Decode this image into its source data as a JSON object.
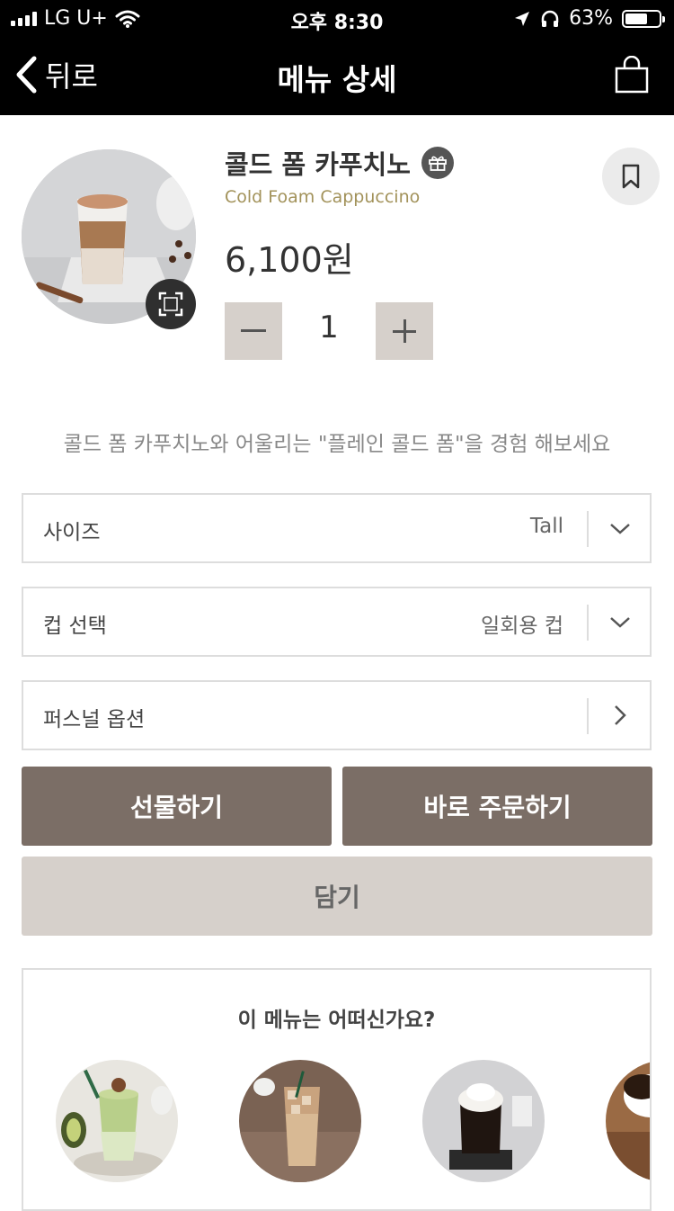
{
  "status_bar": {
    "carrier": "LG U+",
    "time": "오후 8:30",
    "battery": "63%"
  },
  "nav": {
    "back_label": "뒤로",
    "title": "메뉴 상세"
  },
  "product": {
    "name": "콜드 폼 카푸치노",
    "name_en": "Cold Foam Cappuccino",
    "price": "6,100원",
    "quantity": "1"
  },
  "promo_text": "콜드 폼 카푸치노와 어울리는 \"플레인 콜드 폼\"을 경험 해보세요",
  "options": {
    "size": {
      "label": "사이즈",
      "value": "Tall"
    },
    "cup": {
      "label": "컵 선택",
      "value": "일회용 컵"
    },
    "personal": {
      "label": "퍼스널 옵션"
    }
  },
  "buttons": {
    "gift": "선물하기",
    "order_now": "바로 주문하기",
    "add": "담기"
  },
  "recommendation": {
    "title": "이 메뉴는 어떠신가요?"
  },
  "colors": {
    "accent_dark": "#7b6e66",
    "accent_light": "#d6d0cb",
    "english_name": "#a2925a"
  }
}
